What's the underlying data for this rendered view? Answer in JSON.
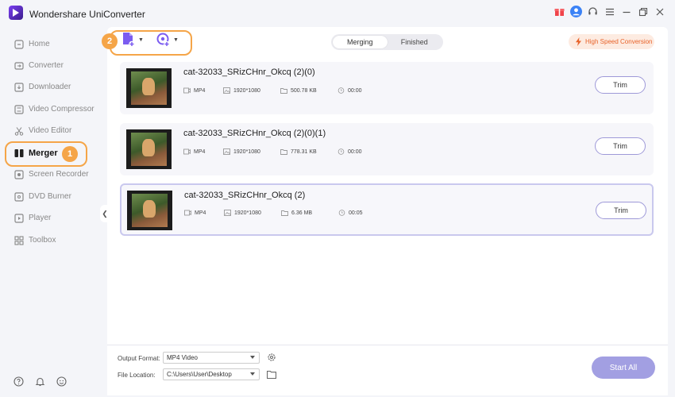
{
  "app": {
    "title": "Wondershare UniConverter"
  },
  "sidebar": {
    "items": [
      {
        "label": "Home",
        "icon": "home-icon"
      },
      {
        "label": "Converter",
        "icon": "converter-icon"
      },
      {
        "label": "Downloader",
        "icon": "downloader-icon"
      },
      {
        "label": "Video Compressor",
        "icon": "compressor-icon"
      },
      {
        "label": "Video Editor",
        "icon": "editor-icon"
      },
      {
        "label": "Merger",
        "icon": "merger-icon",
        "active": true
      },
      {
        "label": "Screen Recorder",
        "icon": "recorder-icon"
      },
      {
        "label": "DVD Burner",
        "icon": "dvd-icon"
      },
      {
        "label": "Player",
        "icon": "player-icon"
      },
      {
        "label": "Toolbox",
        "icon": "toolbox-icon"
      }
    ]
  },
  "steps": {
    "one": "1",
    "two": "2"
  },
  "tabs": {
    "merging": "Merging",
    "finished": "Finished",
    "active": "merging"
  },
  "toolbar": {
    "high_speed": "High Speed Conversion"
  },
  "files": [
    {
      "name": "cat-32033_SRizCHnr_Okcq (2)(0)",
      "format": "MP4",
      "resolution": "1920*1080",
      "size": "500.78 KB",
      "duration": "00:00",
      "trim": "Trim"
    },
    {
      "name": "cat-32033_SRizCHnr_Okcq (2)(0)(1)",
      "format": "MP4",
      "resolution": "1920*1080",
      "size": "778.31 KB",
      "duration": "00:00",
      "trim": "Trim"
    },
    {
      "name": "cat-32033_SRizCHnr_Okcq (2)",
      "format": "MP4",
      "resolution": "1920*1080",
      "size": "6.36 MB",
      "duration": "00:05",
      "trim": "Trim",
      "selected": true
    }
  ],
  "footer": {
    "output_format_label": "Output Format:",
    "output_format_value": "MP4 Video",
    "file_location_label": "File Location:",
    "file_location_value": "C:\\Users\\User\\Desktop",
    "start_all": "Start All"
  },
  "colors": {
    "accent": "#a29fe2",
    "highlight": "#f5a548",
    "hsc": "#e8632a"
  }
}
